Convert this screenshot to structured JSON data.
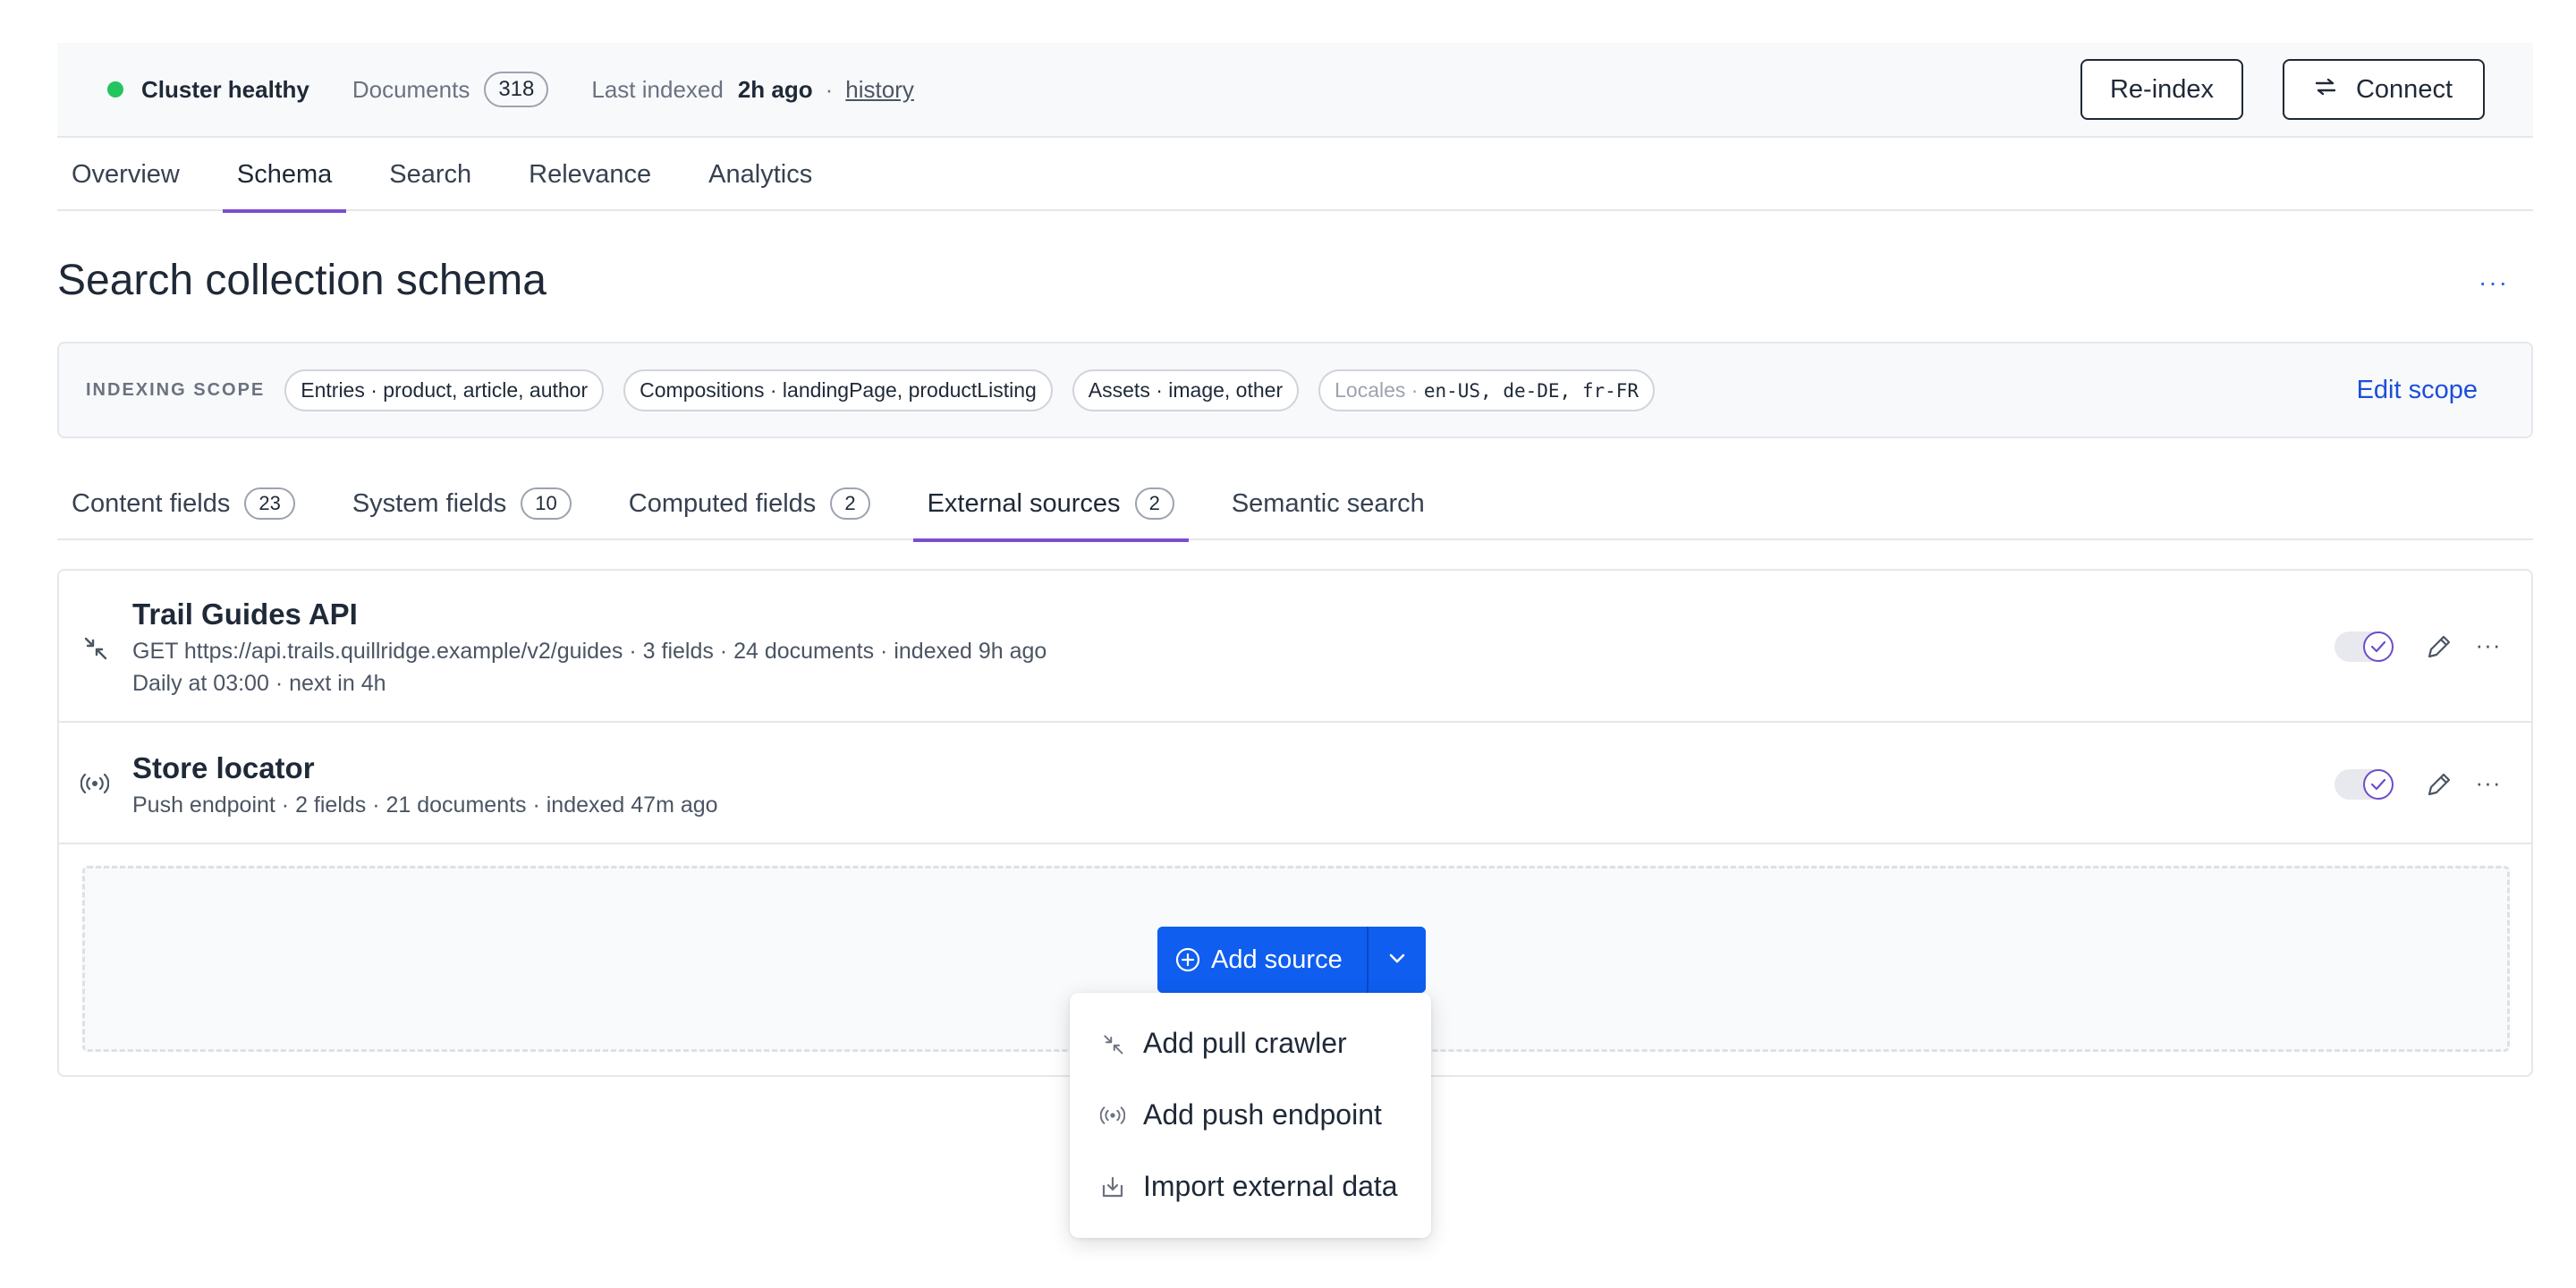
{
  "status": {
    "cluster_label": "Cluster healthy",
    "status_color": "#22c55e",
    "documents_label": "Documents",
    "documents_count": "318",
    "last_indexed_label": "Last indexed",
    "last_indexed_value": "2h ago",
    "separator": "·",
    "history_link": "history",
    "reindex_button": "Re-index",
    "connect_button": "Connect",
    "connect_icon": "swap-arrows-icon"
  },
  "main_tabs": [
    {
      "label": "Overview"
    },
    {
      "label": "Schema",
      "active": true
    },
    {
      "label": "Search"
    },
    {
      "label": "Relevance"
    },
    {
      "label": "Analytics"
    }
  ],
  "page": {
    "title": "Search collection schema",
    "more_icon": "···"
  },
  "scope": {
    "label": "INDEXING SCOPE",
    "chips": [
      "Entries · product, article, author",
      "Compositions · landingPage, productListing",
      "Assets · image, other"
    ],
    "locales_label": "Locales ·",
    "locales_value": "en-US, de-DE, fr-FR",
    "edit_link": "Edit scope"
  },
  "sub_tabs": [
    {
      "label": "Content fields",
      "count": "23"
    },
    {
      "label": "System fields",
      "count": "10"
    },
    {
      "label": "Computed fields",
      "count": "2"
    },
    {
      "label": "External sources",
      "count": "2",
      "active": true
    },
    {
      "label": "Semantic search"
    }
  ],
  "sources": [
    {
      "name": "Trail Guides API",
      "icon": "pull-crawler-icon",
      "line1": "GET https://api.trails.quillridge.example/v2/guides · 3 fields · 24 documents · indexed 9h ago",
      "line2": "Daily at 03:00 · next in 4h",
      "enabled": true
    },
    {
      "name": "Store locator",
      "icon": "broadcast-icon",
      "line1": "Push endpoint · 2 fields · 21 documents · indexed 47m ago",
      "enabled": true
    }
  ],
  "add_source": {
    "label": "Add source",
    "accent": "#0f5ef0"
  },
  "menu": {
    "items": [
      {
        "label": "Add pull crawler",
        "icon": "pull-crawler-icon"
      },
      {
        "label": "Add push endpoint",
        "icon": "broadcast-icon"
      },
      {
        "label": "Import external data",
        "icon": "import-icon"
      }
    ]
  },
  "colors": {
    "tab_underline": "#7c4dce",
    "link": "#1d4ed8"
  }
}
